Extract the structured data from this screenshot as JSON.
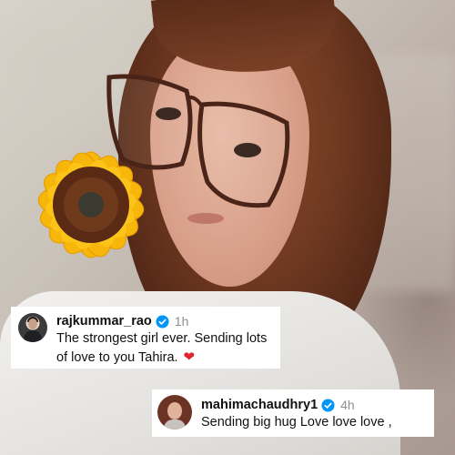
{
  "comments": [
    {
      "username": "rajkummar_rao",
      "time": "1h",
      "text_line1": "The strongest girl ever. Sending lots",
      "text_line2": "of love to you Tahira.",
      "emoji": "❤",
      "verified_icon": "verified-badge-icon",
      "avatar_icon": "avatar-photo"
    },
    {
      "username": "mahimachaudhry1",
      "time": "4h",
      "text_line1": "Sending big hug Love love love ,",
      "verified_icon": "verified-badge-icon",
      "avatar_icon": "avatar-photo"
    }
  ],
  "colors": {
    "verified_blue": "#0095f6",
    "heart_red": "#e0252f",
    "time_gray": "#8e8e8e"
  }
}
